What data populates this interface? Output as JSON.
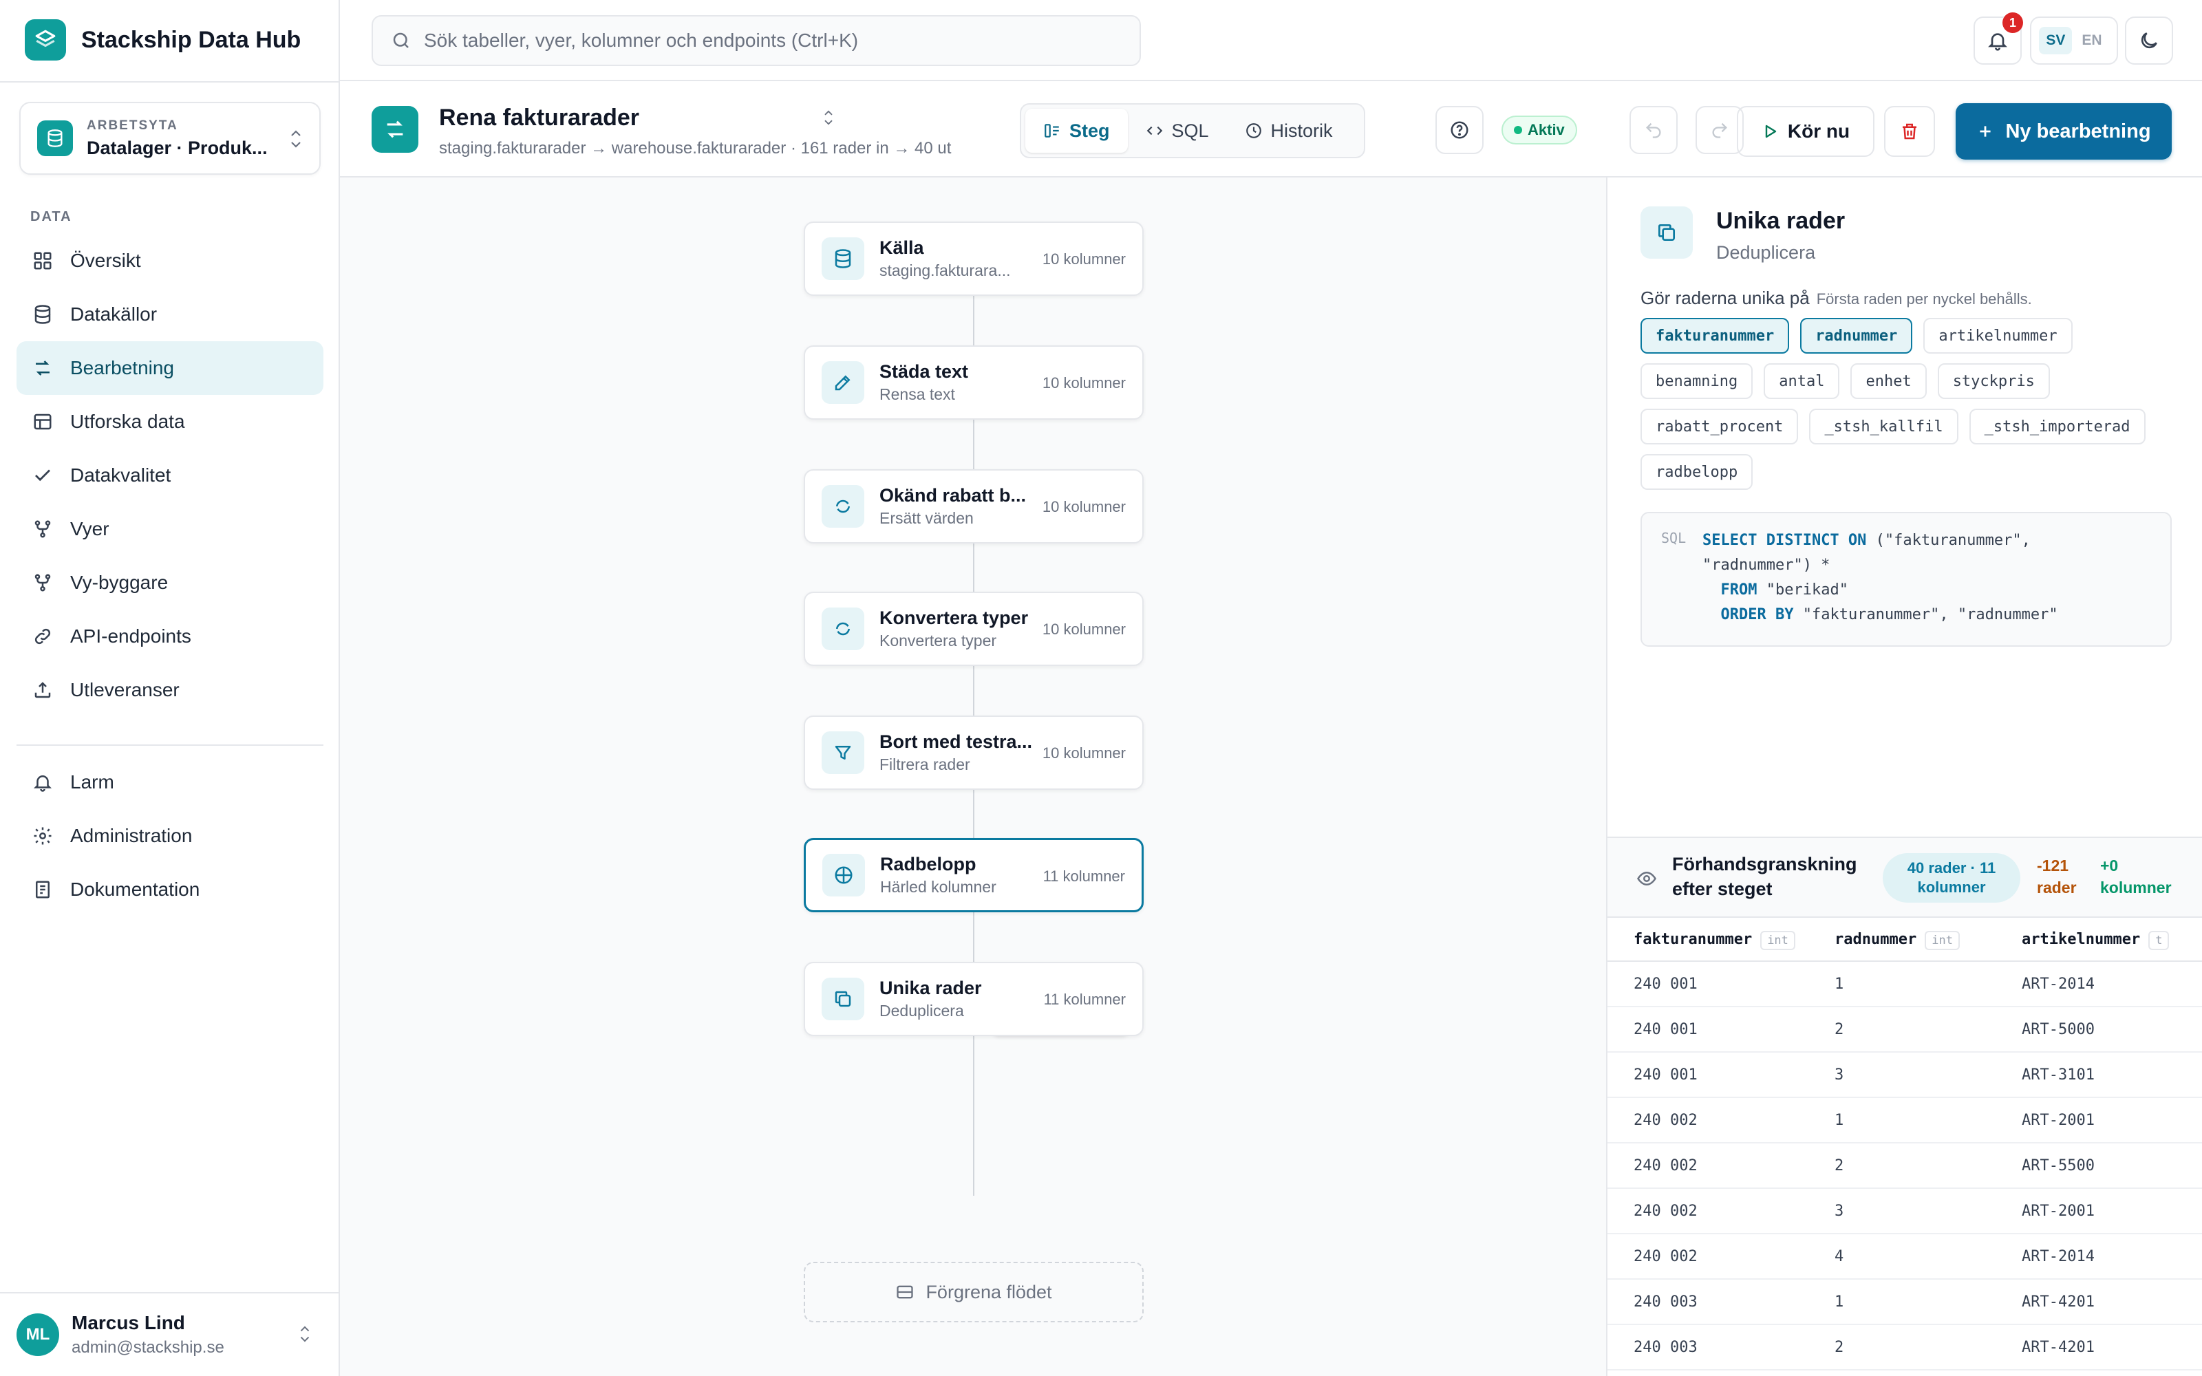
{
  "app": {
    "name": "Stackship Data Hub"
  },
  "workspace": {
    "label": "ARBETSYTA",
    "value": "Datalager · Produk..."
  },
  "sidebar": {
    "section_label": "DATA",
    "items": [
      {
        "label": "Översikt",
        "icon": "grid-icon"
      },
      {
        "label": "Datakällor",
        "icon": "database-icon"
      },
      {
        "label": "Bearbetning",
        "icon": "transform-icon",
        "active": true
      },
      {
        "label": "Utforska data",
        "icon": "table-icon"
      },
      {
        "label": "Datakvalitet",
        "icon": "check-icon"
      },
      {
        "label": "Vyer",
        "icon": "branch-icon"
      },
      {
        "label": "Vy-byggare",
        "icon": "builder-icon"
      },
      {
        "label": "API-endpoints",
        "icon": "link-icon"
      },
      {
        "label": "Utleveranser",
        "icon": "upload-icon"
      }
    ],
    "bottom_items": [
      {
        "label": "Larm",
        "icon": "bell-icon"
      },
      {
        "label": "Administration",
        "icon": "gear-icon"
      },
      {
        "label": "Dokumentation",
        "icon": "document-icon"
      }
    ]
  },
  "user": {
    "initials": "ML",
    "name": "Marcus Lind",
    "email": "admin@stackship.se"
  },
  "topbar": {
    "search_placeholder": "Sök tabeller, vyer, kolumner och endpoints (Ctrl+K)",
    "notification_count": "1",
    "lang_sv": "SV",
    "lang_en": "EN"
  },
  "pipeline": {
    "title": "Rena fakturarader",
    "subtitle": "staging.fakturarader → warehouse.fakturarader · 161 rader in → 40 ut",
    "tabs": [
      {
        "label": "Steg",
        "icon": "steps-icon",
        "active": true
      },
      {
        "label": "SQL",
        "icon": "code-icon"
      },
      {
        "label": "Historik",
        "icon": "clock-icon"
      }
    ],
    "status": "Aktiv",
    "run_label": "Kör nu",
    "new_label": "Ny bearbetning"
  },
  "steps": [
    {
      "title": "Källa",
      "subtitle": "staging.fakturara...",
      "columns": "10 kolumner",
      "icon": "database-icon"
    },
    {
      "title": "Städa text",
      "subtitle": "Rensa text",
      "columns": "10 kolumner",
      "icon": "pencil-icon"
    },
    {
      "title": "Okänd rabatt b...",
      "subtitle": "Ersätt värden",
      "columns": "10 kolumner",
      "icon": "replace-icon"
    },
    {
      "title": "Konvertera typer",
      "subtitle": "Konvertera typer",
      "columns": "10 kolumner",
      "icon": "replace-icon"
    },
    {
      "title": "Bort med testra...",
      "subtitle": "Filtrera rader",
      "columns": "10 kolumner",
      "icon": "filter-icon"
    },
    {
      "title": "Radbelopp",
      "subtitle": "Härled kolumner",
      "columns": "11 kolumner",
      "icon": "plus-circle-icon",
      "selected": true
    },
    {
      "title": "Unika rader",
      "subtitle": "Deduplicera",
      "columns": "11 kolumner",
      "icon": "copy-icon"
    }
  ],
  "branch_label": "Förgrena flödet",
  "detail": {
    "title": "Unika rader",
    "subtitle": "Deduplicera",
    "key_label": "Gör raderna unika på",
    "key_hint": "Första raden per nyckel behålls.",
    "columns": [
      {
        "name": "fakturanummer",
        "selected": true
      },
      {
        "name": "radnummer",
        "selected": true
      },
      {
        "name": "artikelnummer",
        "selected": false
      },
      {
        "name": "benamning",
        "selected": false
      },
      {
        "name": "antal",
        "selected": false
      },
      {
        "name": "enhet",
        "selected": false
      },
      {
        "name": "styckpris",
        "selected": false
      },
      {
        "name": "rabatt_procent",
        "selected": false
      },
      {
        "name": "_stsh_kallfil",
        "selected": false
      },
      {
        "name": "_stsh_importerad",
        "selected": false
      },
      {
        "name": "radbelopp",
        "selected": false
      }
    ],
    "sql_tag": "SQL"
  },
  "preview": {
    "title": "Förhandsgranskning efter steget",
    "badge": "40 rader · 11 kolumner",
    "removed": "-121 rader",
    "added": "+0 kolumner",
    "headers": [
      {
        "name": "fakturanummer",
        "type": "int"
      },
      {
        "name": "radnummer",
        "type": "int"
      },
      {
        "name": "artikelnummer",
        "type": "t"
      }
    ],
    "rows": [
      [
        "240 001",
        "1",
        "ART-2014"
      ],
      [
        "240 001",
        "2",
        "ART-5000"
      ],
      [
        "240 001",
        "3",
        "ART-3101"
      ],
      [
        "240 002",
        "1",
        "ART-2001"
      ],
      [
        "240 002",
        "2",
        "ART-5500"
      ],
      [
        "240 002",
        "3",
        "ART-2001"
      ],
      [
        "240 002",
        "4",
        "ART-2014"
      ],
      [
        "240 003",
        "1",
        "ART-4201"
      ],
      [
        "240 003",
        "2",
        "ART-4201"
      ]
    ]
  },
  "colors": {
    "accent": "#0f9e9b",
    "primary": "#0b6b9e",
    "active_bg": "#e6f4f7",
    "danger": "#dc2626",
    "success": "#047857"
  }
}
